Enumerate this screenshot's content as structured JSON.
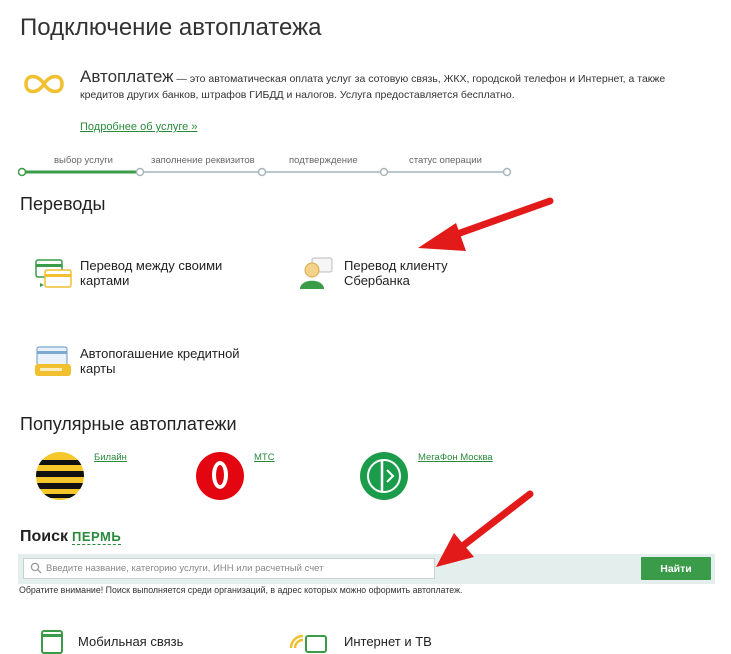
{
  "header": {
    "title": "Подключение автоплатежа"
  },
  "autopayment": {
    "name": "Автоплатеж",
    "description": " — это автоматическая оплата услуг за сотовую связь, ЖКХ, городской телефон и Интернет, а также кредитов других банков, штрафов ГИБДД и налогов. Услуга предоставляется бесплатно.",
    "more_link": "Подробнее об услуге »"
  },
  "steps": {
    "items": [
      {
        "label": "выбор услуги"
      },
      {
        "label": "заполнение реквизитов"
      },
      {
        "label": "подтверждение"
      },
      {
        "label": "статус операции"
      }
    ],
    "active_index": 0
  },
  "transfers": {
    "title": "Переводы",
    "items": [
      {
        "label": "Перевод между своими картами",
        "icon": "cards-transfer-icon"
      },
      {
        "label": "Перевод клиенту Сбербанка",
        "icon": "client-transfer-icon"
      },
      {
        "label": "Автопогашение кредитной карты",
        "icon": "credit-card-repay-icon"
      }
    ]
  },
  "popular": {
    "title": "Популярные автоплатежи",
    "items": [
      {
        "name": "Билайн",
        "icon": "beeline-logo"
      },
      {
        "name": "МТС",
        "icon": "mts-logo"
      },
      {
        "name": "МегаФон Москва",
        "icon": "megafon-logo"
      }
    ]
  },
  "search": {
    "title": "Поиск",
    "city": "ПЕРМЬ",
    "placeholder": "Введите название, категорию услуги, ИНН или расчетный счет",
    "button": "Найти",
    "note": "Обратите внимание! Поиск выполняется среди организаций, в адрес которых можно оформить автоплатеж."
  },
  "categories": {
    "items": [
      {
        "label": "Мобильная связь",
        "icon": "mobile-icon"
      },
      {
        "label": "Интернет и ТВ",
        "icon": "internet-tv-icon"
      }
    ]
  },
  "colors": {
    "accent": "#3a9b48",
    "link": "#2a8a3c",
    "annotation_arrow": "#e21a1a",
    "icon_yellow": "#f0c030"
  }
}
